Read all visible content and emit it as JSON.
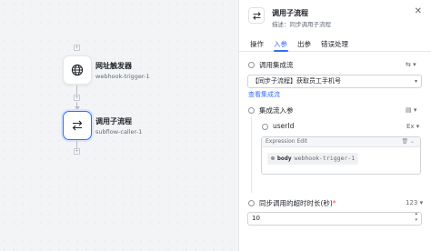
{
  "canvas": {
    "nodes": [
      {
        "title": "网址触发器",
        "subtitle": "webhook-trigger-1"
      },
      {
        "title": "调用子流程",
        "subtitle": "subflow-caller-1"
      }
    ],
    "plus_glyph": "+"
  },
  "panel": {
    "title": "调用子流程",
    "subtitle": "描述：同步调用子流程",
    "close": "✕",
    "tabs": [
      {
        "label": "操作",
        "active": false
      },
      {
        "label": "入参",
        "active": true
      },
      {
        "label": "出参",
        "active": false
      },
      {
        "label": "错误处理",
        "active": false
      }
    ],
    "fields": {
      "integration": {
        "label": "调用集成流",
        "value": "【同步子流程】获取员工手机号",
        "link": "查看集成流",
        "icon_glyph": "⇆ ▾"
      },
      "params": {
        "label": "集成流入参",
        "icon_glyph": "▤ ▾",
        "userid": {
          "label": "userId",
          "type_glyph": "Ex ▾",
          "expression_title": "Expression Edit",
          "expression_icons": "🗑  ⌄",
          "token_key": "body",
          "token_value": "webhook-trigger-1"
        }
      },
      "timeout": {
        "label": "同步调用的超时时长(秒)",
        "required_mark": "*",
        "type_glyph": "123 ▾",
        "value": "10"
      }
    }
  },
  "colors": {
    "accent": "#3370ff",
    "canvas_bg": "#f3f4f6"
  }
}
